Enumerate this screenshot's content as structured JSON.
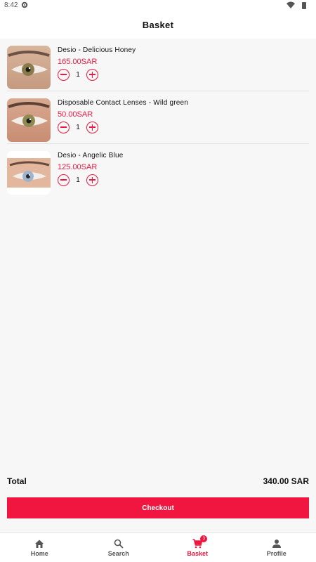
{
  "status_bar": {
    "time": "8:42"
  },
  "header": {
    "title": "Basket"
  },
  "items": [
    {
      "name": "Desio - Delicious Honey",
      "price": "165.00SAR",
      "qty": "1"
    },
    {
      "name": "Disposable Contact Lenses - Wild green",
      "price": "50.00SAR",
      "qty": "1"
    },
    {
      "name": "Desio - Angelic Blue",
      "price": "125.00SAR",
      "qty": "1"
    }
  ],
  "summary": {
    "total_label": "Total",
    "total_value": "340.00 SAR",
    "checkout_label": "Checkout"
  },
  "nav": {
    "home": "Home",
    "search": "Search",
    "basket": "Basket",
    "basket_count": "3",
    "profile": "Profile"
  },
  "colors": {
    "accent": "#f0163f",
    "background": "#f7f7f7"
  },
  "icons": [
    "settings-icon",
    "wifi-icon",
    "battery-icon",
    "minus-circle-icon",
    "plus-circle-icon",
    "home-icon",
    "search-icon",
    "cart-icon",
    "person-icon"
  ]
}
